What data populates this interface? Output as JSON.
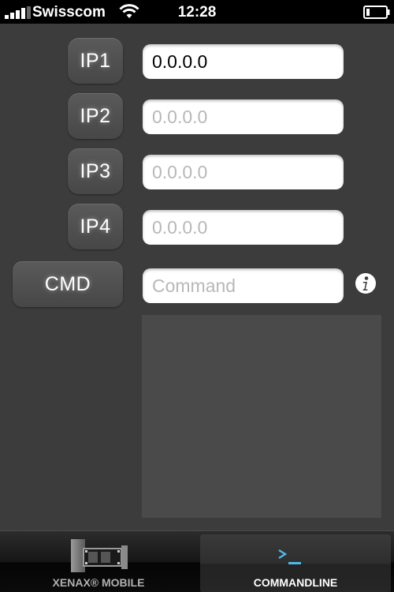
{
  "status_bar": {
    "carrier": "Swisscom",
    "time": "12:28"
  },
  "ip_rows": [
    {
      "label": "IP1",
      "value": "0.0.0.0",
      "placeholder": "0.0.0.0"
    },
    {
      "label": "IP2",
      "value": "",
      "placeholder": "0.0.0.0"
    },
    {
      "label": "IP3",
      "value": "",
      "placeholder": "0.0.0.0"
    },
    {
      "label": "IP4",
      "value": "",
      "placeholder": "0.0.0.0"
    }
  ],
  "command": {
    "label": "CMD",
    "value": "",
    "placeholder": "Command"
  },
  "icons": {
    "info": "info-icon",
    "xenax": "xenax-logo-icon",
    "terminal": "terminal-prompt-icon"
  },
  "tabs": [
    {
      "label": "XENAX® MOBILE",
      "selected": false
    },
    {
      "label": "COMMANDLINE",
      "selected": true
    }
  ],
  "colors": {
    "background": "#3c3c3c",
    "accent_cyan": "#4fb8e8"
  }
}
